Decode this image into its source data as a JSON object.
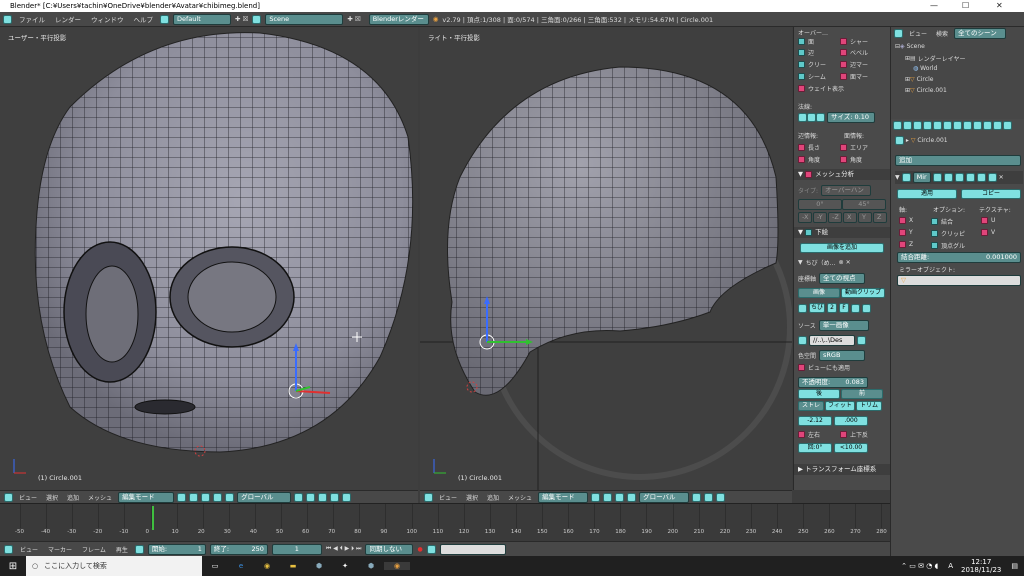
{
  "window": {
    "title": "Blender* [C:¥Users¥tachin¥OneDrive¥blender¥Avatar¥chibimeg.blend]",
    "controls": [
      "—",
      "☐",
      "✕"
    ]
  },
  "topbar": {
    "menus": [
      "ファイル",
      "レンダー",
      "ウィンドウ",
      "ヘルプ"
    ],
    "layout": "Default",
    "scene": "Scene",
    "engine": "Blenderレンダー",
    "stats": "v2.79 | 頂点:1/308 | 面:0/574 | 三角面:0/266 | 三角面:532 | メモリ:54.67M | Circle.001"
  },
  "viewport_left": {
    "label": "ユーザー・平行投影",
    "object": "(1) Circle.001",
    "header": {
      "menus": [
        "ビュー",
        "選択",
        "追加",
        "メッシュ"
      ],
      "mode": "編集モード",
      "orientation": "グローバル"
    }
  },
  "viewport_right": {
    "label": "ライト・平行投影",
    "object": "(1) Circle.001",
    "header": {
      "menus": [
        "ビュー",
        "選択",
        "追加",
        "メッシュ"
      ],
      "mode": "編集モード",
      "orientation": "グローバル"
    }
  },
  "npanel": {
    "overlay_title": "オーバー…",
    "overlay_items": [
      {
        "label": "面",
        "color": "cyan"
      },
      {
        "label": "シャー",
        "color": "pink"
      },
      {
        "label": "辺",
        "color": "cyan"
      },
      {
        "label": "ベベル",
        "color": "pink"
      },
      {
        "label": "クリー",
        "color": "cyan"
      },
      {
        "label": "辺マー",
        "color": "pink"
      },
      {
        "label": "シーム",
        "color": "cyan"
      },
      {
        "label": "面マー",
        "color": "pink"
      }
    ],
    "weight_display": "ウェイト表示",
    "normals_label": "法線:",
    "normals_size": "サイズ: 0.10",
    "edge_info": "辺情報:",
    "face_info": "面情報:",
    "length": "長さ",
    "area": "エリア",
    "angle1": "角度",
    "angle2": "角度",
    "mesh_analysis": "メッシュ分析",
    "type_label": "タイプ:",
    "type_value": "オーバーハン",
    "range_min": "0°",
    "range_max": "45°",
    "axes": [
      "-X",
      "-Y",
      "-Z",
      "X",
      "Y",
      "Z"
    ],
    "background": "下絵",
    "add_image": "画像を追加",
    "image_name": "ちび（め…",
    "axis_label": "座標軸",
    "axis_value": "全ての視点",
    "image_btn": "画像",
    "movie_btn": "動画クリップ",
    "img_tabs": [
      "ちび",
      "2",
      "F"
    ],
    "source_label": "ソース",
    "source_value": "単一画像",
    "path": "//..\\..\\Des",
    "colorspace_label": "色空間",
    "colorspace_value": "sRGB",
    "view_as_render": "ビューにも適用",
    "opacity_label": "不透明度:",
    "opacity_value": "0.083",
    "front": "後",
    "back": "前",
    "stretch": "ストレ",
    "fit": "フィット",
    "crop": "トリム",
    "x_value": "-2.12",
    "y_value": ".000",
    "flip_h": "左右",
    "flip_v": "上下反",
    "rotation": "回:0°",
    "size": "<10.00",
    "transform": "トランスフォーム座標系"
  },
  "outliner": {
    "header": [
      "ビュー",
      "検索",
      "全てのシーン"
    ],
    "items": [
      "Scene",
      "レンダーレイヤー",
      "World",
      "Circle",
      "Circle.001"
    ]
  },
  "properties": {
    "object_name": "Circle.001",
    "add_label": "追加",
    "modifier_name": "Mir",
    "apply": "適用",
    "copy": "コピー",
    "axis_head": "軸:",
    "options_head": "オプション:",
    "texture_head": "テクスチャ:",
    "axes": [
      "X",
      "Y",
      "Z"
    ],
    "options": [
      "結合",
      "クリッピ",
      "頂点グル"
    ],
    "textures": [
      "U",
      "V"
    ],
    "merge_label": "結合距離:",
    "merge_value": "0.001000",
    "mirror_object": "ミラーオブジェクト:"
  },
  "timeline": {
    "ticks": [
      "-50",
      "-40",
      "-30",
      "-20",
      "-10",
      "0",
      "10",
      "20",
      "30",
      "40",
      "50",
      "60",
      "70",
      "80",
      "90",
      "100",
      "110",
      "120",
      "130",
      "140",
      "150",
      "160",
      "170",
      "180",
      "190",
      "200",
      "210",
      "220",
      "230",
      "240",
      "250",
      "260",
      "270",
      "280"
    ],
    "menus": [
      "ビュー",
      "マーカー",
      "フレーム",
      "再生"
    ],
    "start": "開始:",
    "start_value": "1",
    "end": "終了:",
    "end_value": "250",
    "current": "1",
    "sync": "同期しない"
  },
  "taskbar": {
    "search_placeholder": "ここに入力して検索",
    "time": "12:17",
    "date": "2018/11/23",
    "ime": "A"
  }
}
